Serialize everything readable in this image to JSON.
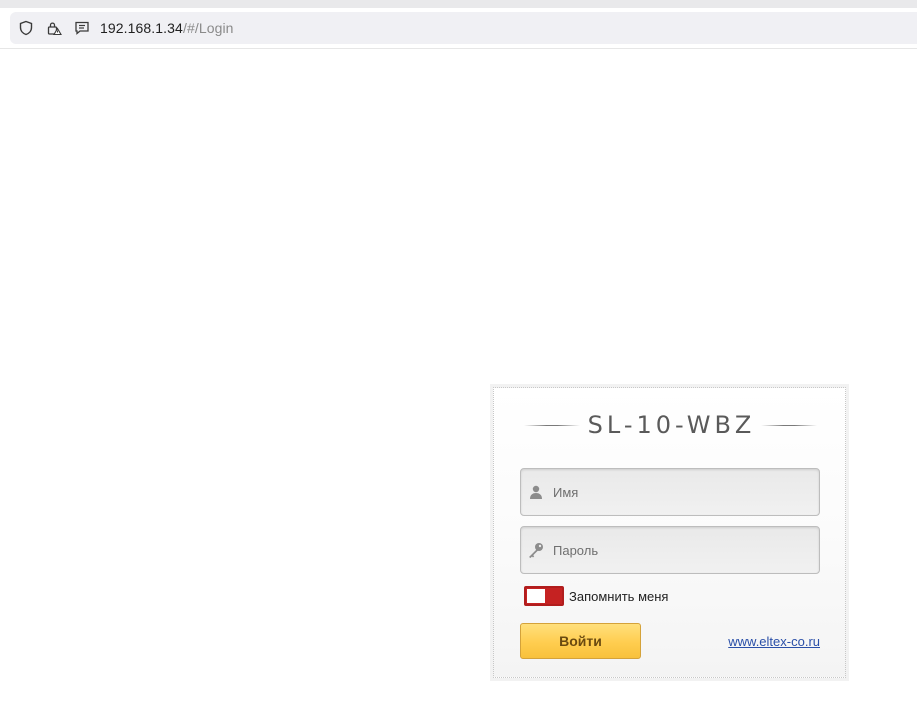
{
  "browser": {
    "url_host": "192.168.1.34",
    "url_path": "/#/Login",
    "icons": [
      "shield-icon",
      "lock-warning-icon",
      "reader-icon"
    ]
  },
  "login": {
    "device_title": "SL-10-WBZ",
    "username_placeholder": "Имя",
    "password_placeholder": "Пароль",
    "remember_label": "Запомнить меня",
    "remember_checked": false,
    "login_button": "Войти",
    "site_link": "www.eltex-co.ru"
  },
  "colors": {
    "toggle": "#c52222",
    "button": "#ffcd4f",
    "link": "#2a4fa8"
  }
}
